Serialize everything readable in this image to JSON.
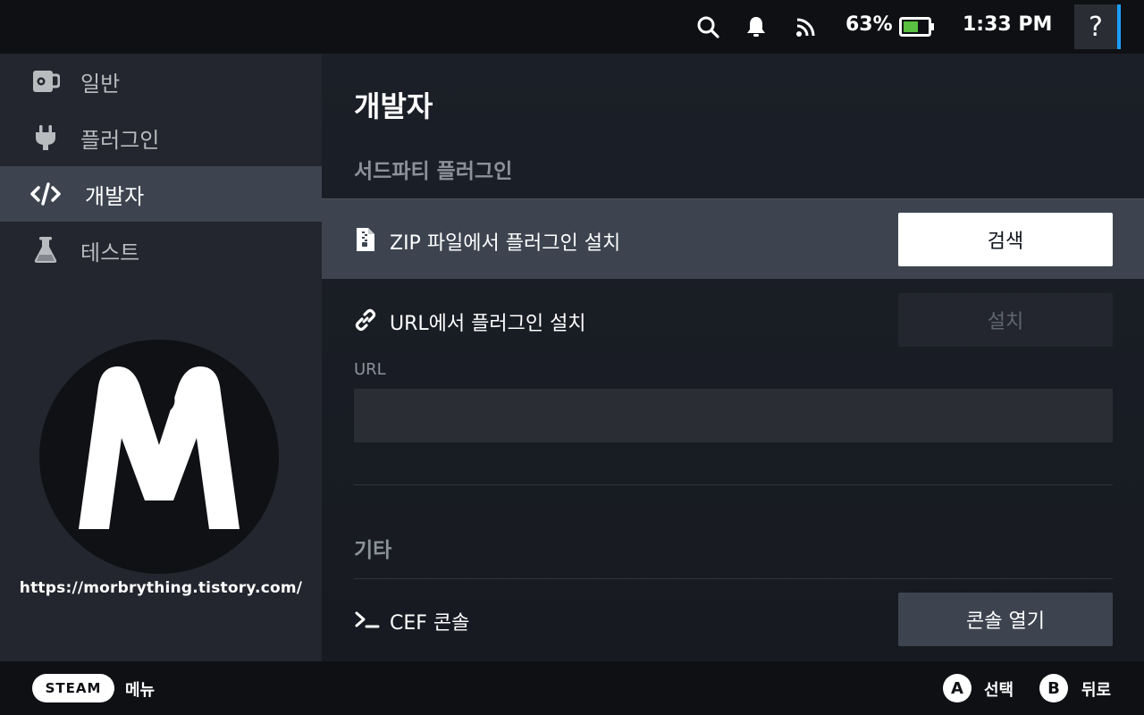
{
  "status_bar": {
    "battery_percent": "63%",
    "battery_level": 0.63,
    "time": "1:33 PM",
    "help_label": "?",
    "icons": [
      "search-icon",
      "bell-icon",
      "signal-icon",
      "battery-icon"
    ]
  },
  "sidebar": {
    "items": [
      {
        "label": "일반",
        "icon": "coffee-mug-icon",
        "active": false
      },
      {
        "label": "플러그인",
        "icon": "plug-icon",
        "active": false
      },
      {
        "label": "개발자",
        "icon": "code-icon",
        "active": true
      },
      {
        "label": "테스트",
        "icon": "flask-icon",
        "active": false
      }
    ],
    "logo_url": "https://morbrything.tistory.com/"
  },
  "main": {
    "title": "개발자",
    "third_party_section": "서드파티 플러그인",
    "zip_row_label": "ZIP 파일에서 플러그인 설치",
    "browse_button": "검색",
    "url_row_label": "URL에서 플러그인 설치",
    "install_button": "설치",
    "url_field_label": "URL",
    "url_value": "",
    "other_section": "기타",
    "cef_row_label": "CEF 콘솔",
    "open_console_button": "콘솔 열기"
  },
  "bottom_bar": {
    "steam_label": "STEAM",
    "menu_label": "메뉴",
    "a_glyph": "A",
    "a_label": "선택",
    "b_glyph": "B",
    "b_label": "뒤로"
  },
  "colors": {
    "accent": "#1a9fff",
    "sidebar_bg": "#23262e",
    "active_bg": "#3d4450",
    "battery_green": "#59bf40"
  }
}
